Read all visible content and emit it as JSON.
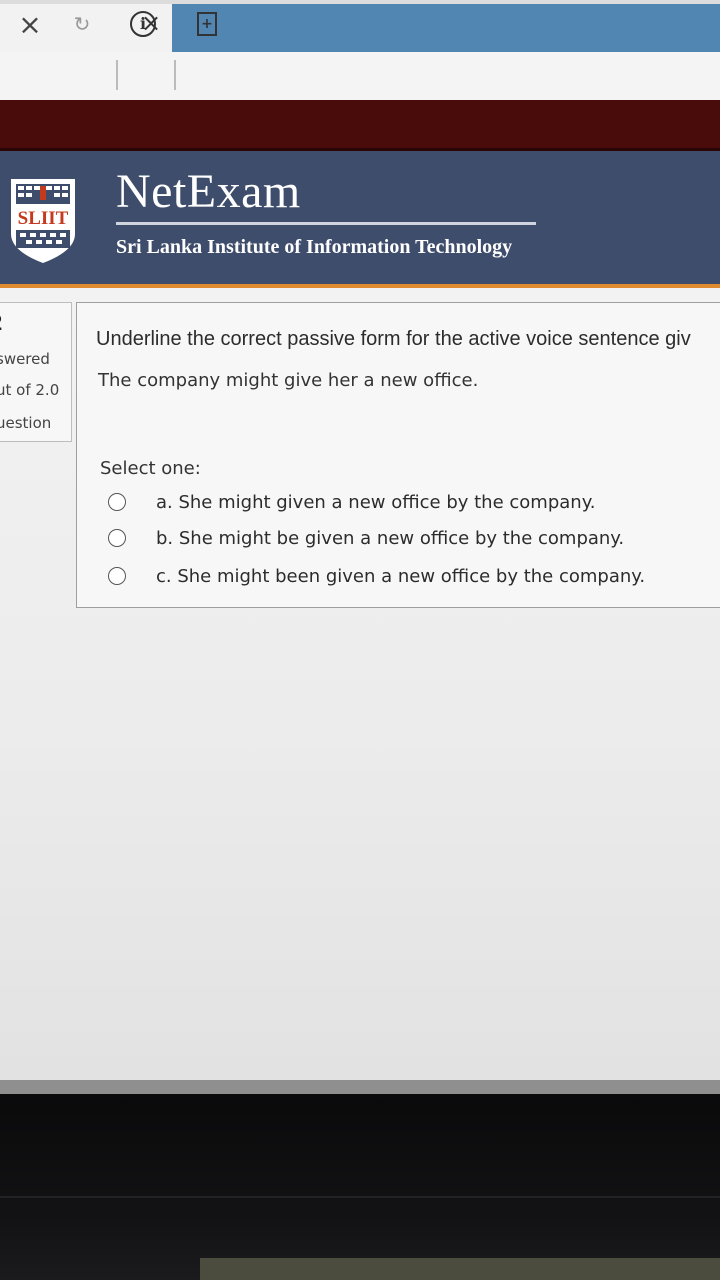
{
  "browser": {
    "tab_close_glyph": "×",
    "toolbar": {
      "stop_glyph": "×",
      "reload_glyph": "↻",
      "info_glyph": "i",
      "page_glyph": "+"
    },
    "colors": {
      "inactive_tab": "#5186b3",
      "red_band": "#4a0b0b"
    }
  },
  "header": {
    "title": "NetExam",
    "subtitle": "Sri Lanka Institute of Information Technology",
    "logo_text": "SLIIT",
    "colors": {
      "background": "#3f4d6c",
      "accent": "#e08a2e"
    }
  },
  "question_info": {
    "number": "2",
    "status": "swered",
    "marks": "ut of 2.0",
    "flag": "uestion"
  },
  "question": {
    "prompt": "Underline the correct passive form for the active voice sentence giv",
    "sentence": "The company might give her a new office.",
    "select_label": "Select one:",
    "options": [
      {
        "label": "a. She might given a new office by the company."
      },
      {
        "label": "b. She might be given a new office by the company."
      },
      {
        "label": "c. She might been given a new office by the company."
      }
    ]
  }
}
